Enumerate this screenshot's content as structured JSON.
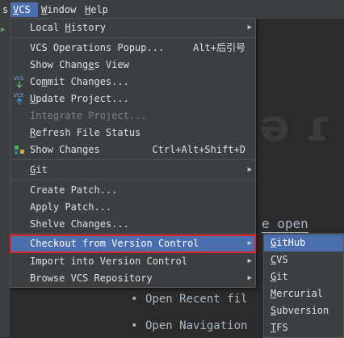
{
  "menubar": {
    "items": [
      {
        "label": "s",
        "mnemonic": ""
      },
      {
        "label": "VCS",
        "mnemonic": "V",
        "active": true
      },
      {
        "label": "Window",
        "mnemonic": "W"
      },
      {
        "label": "Help",
        "mnemonic": "H"
      }
    ]
  },
  "editor": {
    "background_glyphs": "ǝ  ɾ",
    "hint_open": "e open",
    "bullets": [
      "Open Recent fil",
      "Open Navigation"
    ]
  },
  "vcs_menu": {
    "items": [
      {
        "label": "Local History",
        "mnemonic_index": 6,
        "submenu": true
      },
      {
        "label": "VCS Operations Popup...",
        "shortcut": "Alt+后引号"
      },
      {
        "label": "Show Changes View"
      },
      {
        "label": "Commit Changes...",
        "icon": "vcs-commit-icon"
      },
      {
        "label": "Update Project...",
        "icon": "vcs-update-icon"
      },
      {
        "label": "Integrate Project...",
        "disabled": true
      },
      {
        "label": "Refresh File Status"
      },
      {
        "label": "Show Changes",
        "shortcut": "Ctrl+Alt+Shift+D",
        "icon": "show-changes-icon"
      },
      {
        "label": "Git",
        "submenu": true
      },
      {
        "label": "Create Patch..."
      },
      {
        "label": "Apply Patch..."
      },
      {
        "label": "Shelve Changes..."
      },
      {
        "label": "Checkout from Version Control",
        "submenu": true,
        "highlighted": true
      },
      {
        "label": "Import into Version Control",
        "submenu": true
      },
      {
        "label": "Browse VCS Repository",
        "submenu": true
      }
    ]
  },
  "checkout_submenu": {
    "items": [
      {
        "label": "GitHub",
        "selected": true
      },
      {
        "label": "CVS"
      },
      {
        "label": "Git"
      },
      {
        "label": "Mercurial"
      },
      {
        "label": "Subversion"
      },
      {
        "label": "TFS"
      }
    ]
  },
  "colors": {
    "menu_bg": "#3c3f41",
    "selection": "#4b6eaf",
    "highlight_outline": "#e0262b",
    "editor_bg": "#2b2b2b"
  }
}
